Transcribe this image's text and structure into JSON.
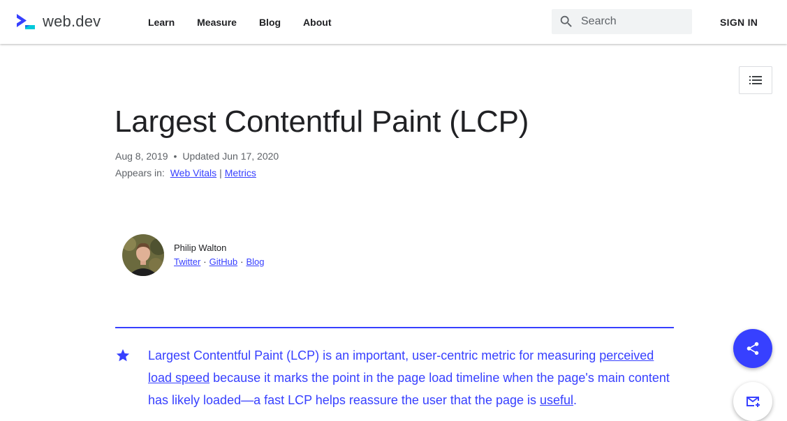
{
  "brand": {
    "name": "web.dev",
    "accent": "#3740ff"
  },
  "nav": {
    "items": [
      {
        "label": "Learn"
      },
      {
        "label": "Measure"
      },
      {
        "label": "Blog"
      },
      {
        "label": "About"
      }
    ]
  },
  "search": {
    "placeholder": "Search",
    "value": ""
  },
  "auth": {
    "sign_in_label": "SIGN IN"
  },
  "toc": {
    "icon": "list-icon"
  },
  "article": {
    "title": "Largest Contentful Paint (LCP)",
    "published": "Aug 8, 2019",
    "updated": "Updated Jun 17, 2020",
    "appears_in_label": "Appears in:",
    "collections": [
      {
        "label": "Web Vitals"
      },
      {
        "label": "Metrics"
      }
    ],
    "collection_separator": "|"
  },
  "author": {
    "name": "Philip Walton",
    "links": [
      {
        "label": "Twitter"
      },
      {
        "label": "GitHub"
      },
      {
        "label": "Blog"
      }
    ],
    "link_separator": "·"
  },
  "callout": {
    "icon": "star-icon",
    "text_before": "Largest Contentful Paint (LCP) is an important, user-centric metric for measuring ",
    "link1": "perceived load speed",
    "text_middle": " because it marks the point in the page load timeline when the page's main content has likely loaded—a fast LCP helps reassure the user that the page is ",
    "link2": "useful",
    "text_after": "."
  },
  "fabs": {
    "share_icon": "share-icon",
    "subscribe_icon": "mail-icon"
  }
}
